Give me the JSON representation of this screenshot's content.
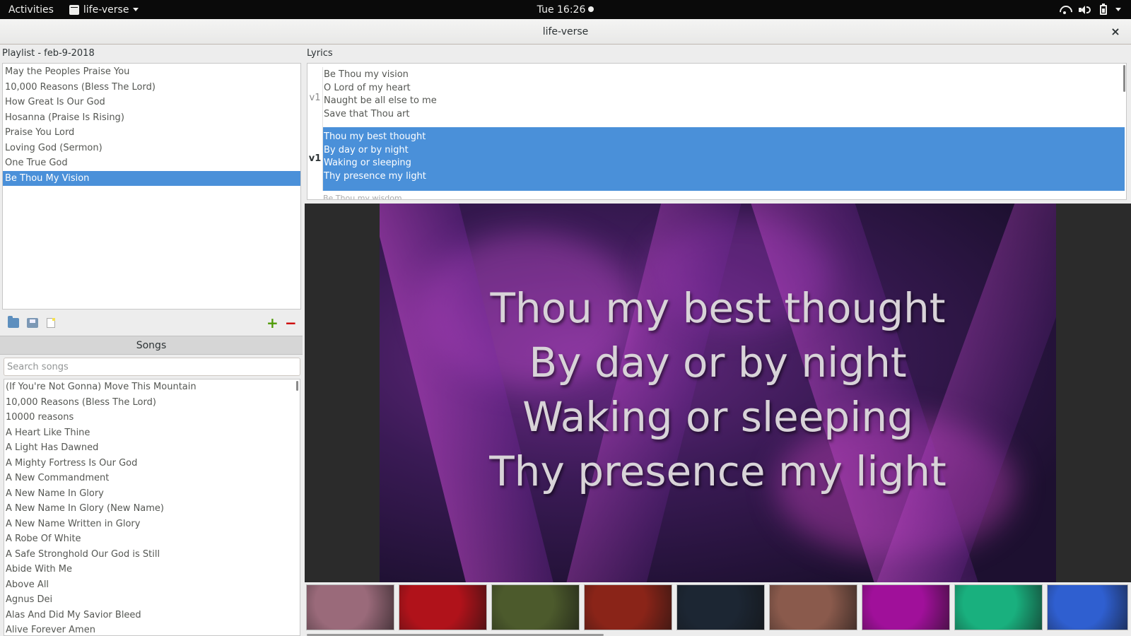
{
  "topbar": {
    "activities": "Activities",
    "app_name": "life-verse",
    "clock": "Tue 16:26"
  },
  "window": {
    "title": "life-verse",
    "close": "×"
  },
  "playlist": {
    "label": "Playlist - feb-9-2018",
    "items": [
      "May the Peoples Praise You",
      "10,000 Reasons (Bless The Lord)",
      "How Great Is Our God",
      "Hosanna (Praise Is Rising)",
      "Praise You Lord",
      "Loving God (Sermon)",
      "One True God",
      "Be Thou My Vision"
    ],
    "selected_index": 7
  },
  "songs": {
    "header": "Songs",
    "search_placeholder": "Search songs",
    "items": [
      "(If You're Not Gonna) Move This Mountain",
      "10,000 Reasons (Bless The Lord)",
      "10000 reasons",
      "A Heart Like Thine",
      "A Light Has Dawned",
      "A Mighty Fortress Is Our God",
      "A New Commandment",
      "A New Name In Glory",
      "A New Name In Glory (New Name)",
      "A New Name Written in Glory",
      "A Robe Of White",
      "A Safe Stronghold Our God is Still",
      "Abide With Me",
      "Above All",
      "Agnus Dei",
      "Alas And Did My Savior Bleed",
      "Alive Forever Amen"
    ]
  },
  "lyrics": {
    "label": "Lyrics",
    "verses": [
      {
        "tag": "v1",
        "lines": [
          "Be Thou my vision",
          "O Lord of my heart",
          "Naught be all else to me",
          "Save that Thou art"
        ]
      },
      {
        "tag": "v1",
        "lines": [
          "Thou my best thought",
          "By day or by night",
          "Waking or sleeping",
          "Thy presence my light"
        ]
      }
    ],
    "selected_index": 1,
    "partial_next": "Be Thou my wisdom"
  },
  "preview": {
    "lines": [
      "Thou my best thought",
      "By day or by night",
      "Waking or sleeping",
      "Thy presence my light"
    ]
  },
  "backgrounds": [
    {
      "name": "pink-bokeh",
      "color": "#9a6a7a"
    },
    {
      "name": "red-texture",
      "color": "#b0121a"
    },
    {
      "name": "green-grunge",
      "color": "#4c5a2c"
    },
    {
      "name": "red-grunge",
      "color": "#8a2418"
    },
    {
      "name": "dark-blue",
      "color": "#1c2633"
    },
    {
      "name": "brown-speckle",
      "color": "#8a5a4c"
    },
    {
      "name": "purple-rings",
      "color": "#a0109a"
    },
    {
      "name": "teal-aurora",
      "color": "#19b07e"
    },
    {
      "name": "blue-mountain",
      "color": "#2f5fd0"
    }
  ],
  "colors": {
    "accent": "#4a90d9",
    "add": "#4e9a06",
    "remove": "#cc0000"
  }
}
